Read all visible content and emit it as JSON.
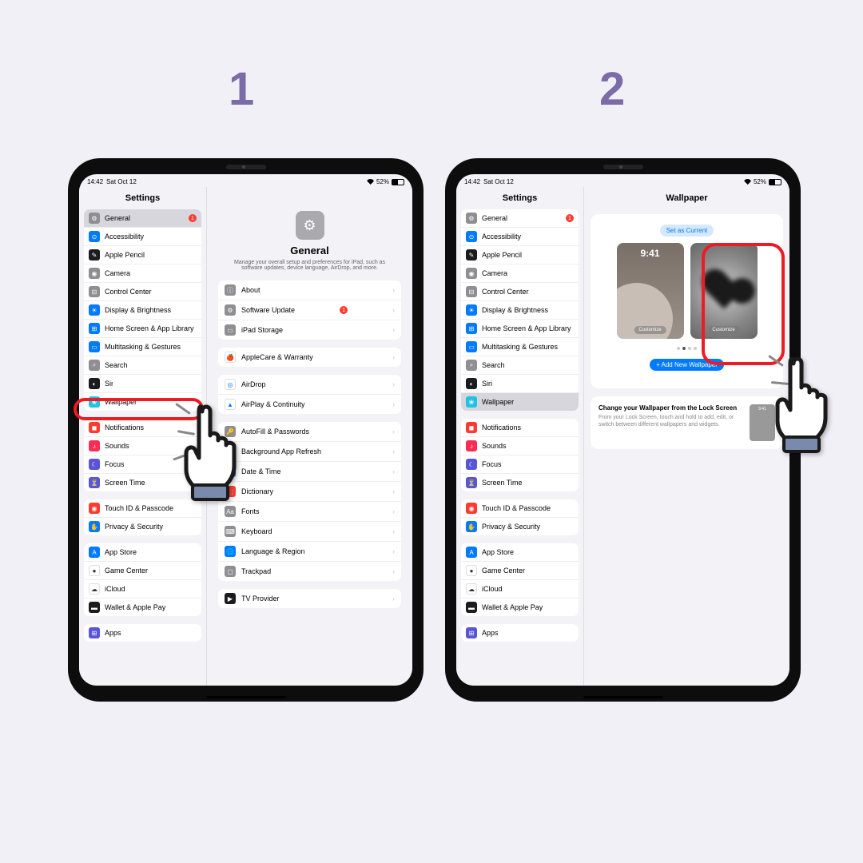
{
  "steps": {
    "one": "1",
    "two": "2"
  },
  "status": {
    "time": "14:42",
    "date": "Sat Oct 12",
    "battery": "52%"
  },
  "sidebar": {
    "title": "Settings",
    "g1": [
      "General",
      "Accessibility",
      "Apple Pencil",
      "Camera",
      "Control Center",
      "Display & Brightness",
      "Home Screen & App Library",
      "Multitasking & Gestures",
      "Search",
      "Siri",
      "Wallpaper"
    ],
    "g2": [
      "Notifications",
      "Sounds",
      "Focus",
      "Screen Time"
    ],
    "g3": [
      "Touch ID & Passcode",
      "Privacy & Security"
    ],
    "g4": [
      "App Store",
      "Game Center",
      "iCloud",
      "Wallet & Apple Pay"
    ],
    "g5": [
      "Apps"
    ],
    "badge": "1"
  },
  "general": {
    "title": "General",
    "sub": "Manage your overall setup and preferences for iPad, such as software updates, device language, AirDrop, and more.",
    "r1": [
      "About",
      "Software Update",
      "iPad Storage"
    ],
    "r2": [
      "AppleCare & Warranty"
    ],
    "r3": [
      "AirDrop",
      "AirPlay & Continuity"
    ],
    "r4": [
      "AutoFill & Passwords",
      "Background App Refresh",
      "Date & Time",
      "Dictionary",
      "Fonts",
      "Keyboard",
      "Language & Region",
      "Trackpad"
    ],
    "r5": [
      "TV Provider"
    ],
    "badge": "1"
  },
  "wallpaper": {
    "title": "Wallpaper",
    "set_current": "Set as Current",
    "time": "9:41",
    "customize": "Customize",
    "add_new": "+ Add New Wallpaper",
    "info_title": "Change your Wallpaper from the Lock Screen",
    "info_body": "From your Lock Screen, touch and hold to add, edit, or switch between different wallpapers and widgets."
  }
}
